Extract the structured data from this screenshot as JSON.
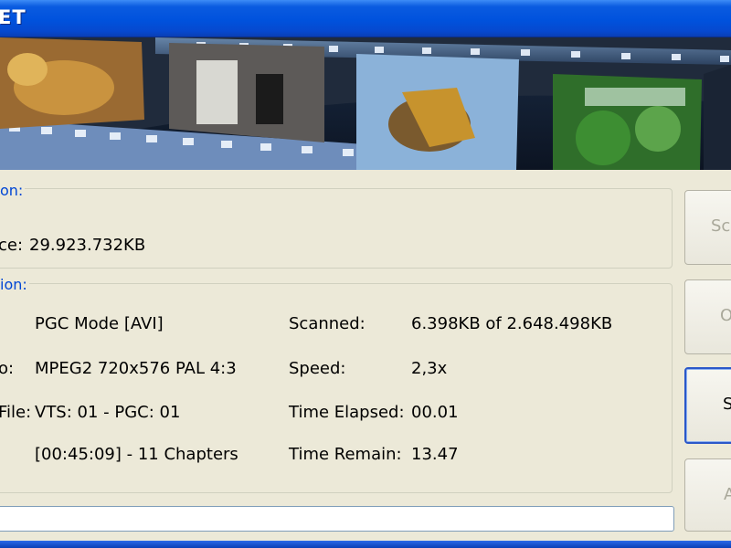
{
  "window": {
    "title": "ET"
  },
  "source_group": {
    "title": "on:",
    "size_label": "ce:",
    "size_value": "29.923.732KB"
  },
  "info_group": {
    "title": "ion:",
    "rows": [
      {
        "label": "",
        "value": "PGC Mode [AVI]"
      },
      {
        "label": "o:",
        "value": "MPEG2 720x576 PAL 4:3"
      },
      {
        "label": "File:",
        "value": "VTS: 01 - PGC: 01"
      },
      {
        "label": "",
        "value": "[00:45:09] - 11 Chapters"
      }
    ],
    "stats": [
      {
        "label": "Scanned:",
        "value": "6.398KB of 2.648.498KB"
      },
      {
        "label": "Speed:",
        "value": "2,3x"
      },
      {
        "label": "Time Elapsed:",
        "value": "00.01"
      },
      {
        "label": "Time Remain:",
        "value": "13.47"
      }
    ]
  },
  "buttons": {
    "b1": "Sc",
    "b2": "O",
    "b3": "S",
    "b4": "A"
  },
  "progress": {
    "value": 0.0
  }
}
